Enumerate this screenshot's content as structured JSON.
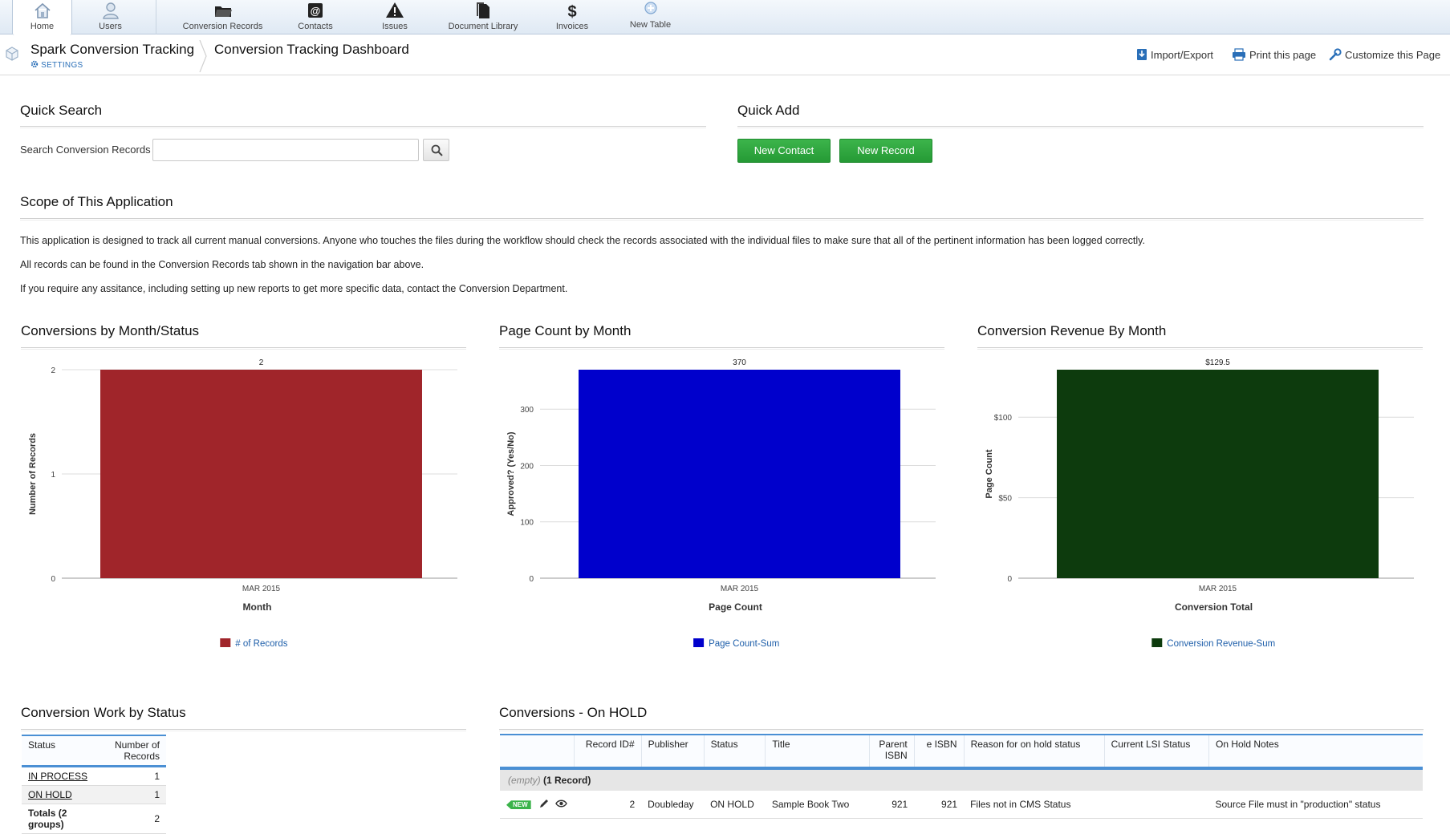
{
  "nav": {
    "items": [
      {
        "label": "Home",
        "icon": "home-icon"
      },
      {
        "label": "Users",
        "icon": "user-icon"
      },
      {
        "label": "Conversion Records",
        "icon": "folder-icon"
      },
      {
        "label": "Contacts",
        "icon": "at-icon"
      },
      {
        "label": "Issues",
        "icon": "warning-icon"
      },
      {
        "label": "Document Library",
        "icon": "documents-icon"
      },
      {
        "label": "Invoices",
        "icon": "dollar-icon"
      },
      {
        "label": "New Table",
        "icon": "plus-circle-icon"
      }
    ],
    "active": "Home"
  },
  "header": {
    "app_name": "Spark Conversion Tracking",
    "settings_label": "SETTINGS",
    "page_title": "Conversion Tracking Dashboard",
    "actions": {
      "import_export": "Import/Export",
      "print": "Print this page",
      "customize": "Customize this Page"
    }
  },
  "quick_search": {
    "title": "Quick Search",
    "label": "Search Conversion Records",
    "value": ""
  },
  "quick_add": {
    "title": "Quick Add",
    "new_contact": "New Contact",
    "new_record": "New Record"
  },
  "scope": {
    "title": "Scope of This Application",
    "paragraphs": [
      "This application is designed to track all current manual conversions. Anyone who touches the files during the workflow should check the records associated with the individual files to make sure that all of the pertinent information has been logged correctly.",
      "All records can be found in the Conversion Records tab shown in the navigation bar above.",
      "If you require any assitance, including setting up new reports to get more specific data, contact the Conversion Department."
    ]
  },
  "charts": {
    "c1_title": "Conversions by Month/Status",
    "c2_title": "Page Count by Month",
    "c3_title": "Conversion Revenue By Month"
  },
  "chart_data": [
    {
      "type": "bar",
      "title": "Conversions by Month/Status",
      "categories": [
        "MAR 2015"
      ],
      "series": [
        {
          "name": "# of Records",
          "values": [
            2
          ]
        }
      ],
      "data_labels": [
        "2"
      ],
      "xlabel": "Month",
      "ylabel": "Number of Records",
      "ylim": [
        0,
        2
      ],
      "yticks": [
        0,
        1,
        2
      ],
      "ytick_labels": [
        "0",
        "1",
        "2"
      ],
      "color": "#a0252a",
      "grid": true,
      "legend": "bottom"
    },
    {
      "type": "bar",
      "title": "Page Count by Month",
      "categories": [
        "MAR 2015"
      ],
      "series": [
        {
          "name": "Page Count-Sum",
          "values": [
            370
          ]
        }
      ],
      "data_labels": [
        "370"
      ],
      "xlabel": "Page Count",
      "ylabel": "Approved? (Yes/No)",
      "ylim": [
        0,
        370
      ],
      "yticks": [
        0,
        100,
        200,
        300
      ],
      "ytick_labels": [
        "0",
        "100",
        "200",
        "300"
      ],
      "color": "#0000cc",
      "grid": true,
      "legend": "bottom"
    },
    {
      "type": "bar",
      "title": "Conversion Revenue By Month",
      "categories": [
        "MAR 2015"
      ],
      "series": [
        {
          "name": "Conversion Revenue-Sum",
          "values": [
            129.5
          ]
        }
      ],
      "data_labels": [
        "$129.5"
      ],
      "xlabel": "Conversion Total",
      "ylabel": "Page Count",
      "ylim": [
        0,
        129.5
      ],
      "yticks": [
        0,
        50,
        100
      ],
      "ytick_labels": [
        "0",
        "$50",
        "$100"
      ],
      "color": "#0d3b0d",
      "grid": true,
      "legend": "bottom"
    }
  ],
  "work_by_status": {
    "title": "Conversion Work by Status",
    "headers": [
      "Status",
      "Number of Records"
    ],
    "rows": [
      {
        "status": "IN PROCESS",
        "count": "1"
      },
      {
        "status": "ON HOLD",
        "count": "1"
      }
    ],
    "total_label": "Totals (2 groups)",
    "total_value": "2"
  },
  "on_hold": {
    "title": "Conversions - On HOLD",
    "headers": [
      "Record ID#",
      "Publisher",
      "Status",
      "Title",
      "Parent ISBN",
      "e ISBN",
      "Reason for on hold status",
      "Current LSI Status",
      "On Hold Notes"
    ],
    "group_empty": "(empty)",
    "group_count": "(1 Record)",
    "new_badge": "NEW",
    "rows": [
      {
        "record_id": "2",
        "publisher": "Doubleday",
        "status": "ON HOLD",
        "title": "Sample Book Two",
        "parent_isbn": "921",
        "e_isbn": "921",
        "reason": "Files not in CMS Status",
        "lsi_status": "",
        "notes": "Source File must in \"production\" status"
      }
    ]
  }
}
